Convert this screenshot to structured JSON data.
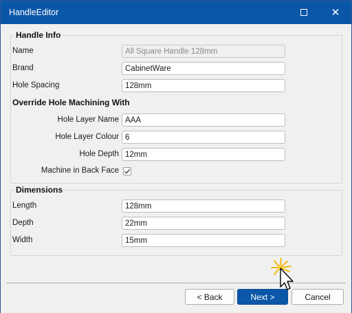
{
  "window": {
    "title": "HandleEditor"
  },
  "handle_info": {
    "legend": "Handle Info",
    "fields": [
      {
        "label": "Name",
        "value": "All Square Handle 128mm",
        "disabled": true
      },
      {
        "label": "Brand",
        "value": "CabinetWare"
      },
      {
        "label": "Hole Spacing",
        "value": "128mm"
      }
    ]
  },
  "override": {
    "heading": "Override Hole Machining With",
    "fields": [
      {
        "label": "Hole Layer Name",
        "value": "AAA"
      },
      {
        "label": "Hole Layer Colour",
        "value": "6"
      },
      {
        "label": "Hole Depth",
        "value": "12mm"
      }
    ],
    "checkbox": {
      "label": "Machine in Back Face",
      "checked": true
    }
  },
  "dimensions": {
    "legend": "Dimensions",
    "fields": [
      {
        "label": "Length",
        "value": "128mm"
      },
      {
        "label": "Depth",
        "value": "22mm"
      },
      {
        "label": "Width",
        "value": "15mm"
      }
    ]
  },
  "buttons": {
    "back": "< Back",
    "next": "Next >",
    "cancel": "Cancel"
  },
  "colors": {
    "titlebar": "#0a57a8",
    "primary_button": "#0a57a8"
  }
}
